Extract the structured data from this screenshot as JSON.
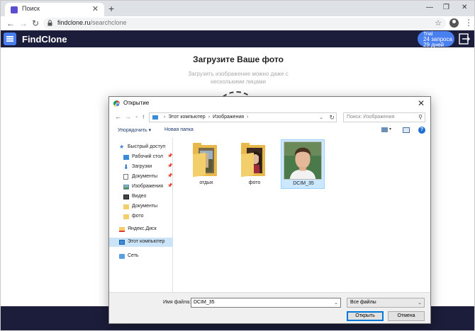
{
  "browser": {
    "tab_title": "Поиск",
    "url_host": "findclone.ru",
    "url_path": "/searchclone"
  },
  "site": {
    "logo": "FindClone",
    "trial": {
      "line1": "Trial",
      "line2": "24 запроса",
      "line3": "29 дней"
    },
    "heading": "Загрузите Ваше фото",
    "subheading": "Загрузить изображение можно даже с несколькими лицами"
  },
  "dialog": {
    "title": "Открытие",
    "address_path": [
      "Этот компьютер",
      "Изображения"
    ],
    "search_placeholder": "Поиск: Изображения",
    "organize_label": "Упорядочить ▾",
    "new_folder_label": "Новая папка",
    "nav_items": [
      {
        "label": "Быстрый доступ",
        "icon": "star-icon"
      },
      {
        "label": "Рабочий стол",
        "icon": "desktop-icon"
      },
      {
        "label": "Загрузки",
        "icon": "download-icon"
      },
      {
        "label": "Документы",
        "icon": "document-icon"
      },
      {
        "label": "Изображения",
        "icon": "pictures-icon"
      },
      {
        "label": "Видео",
        "icon": "video-icon"
      },
      {
        "label": "Документы",
        "icon": "folder-icon"
      },
      {
        "label": "фото",
        "icon": "folder-icon"
      },
      {
        "label": "Яндекс.Диск",
        "icon": "yandex-disk-icon"
      },
      {
        "label": "Этот компьютер",
        "icon": "computer-icon"
      },
      {
        "label": "Сеть",
        "icon": "network-icon"
      }
    ],
    "files": [
      {
        "name": "отдых",
        "kind": "folder"
      },
      {
        "name": "фото",
        "kind": "folder"
      },
      {
        "name": "DCIM_35",
        "kind": "image"
      }
    ],
    "filename_label": "Имя файла:",
    "filename_value": "DCIM_35",
    "filetype_value": "Все файлы",
    "open_label": "Открыть",
    "cancel_label": "Отмена"
  },
  "colors": {
    "brand_dark": "#1b1d3a",
    "brand_blue": "#4a7ff0",
    "selection": "#cce8ff"
  }
}
